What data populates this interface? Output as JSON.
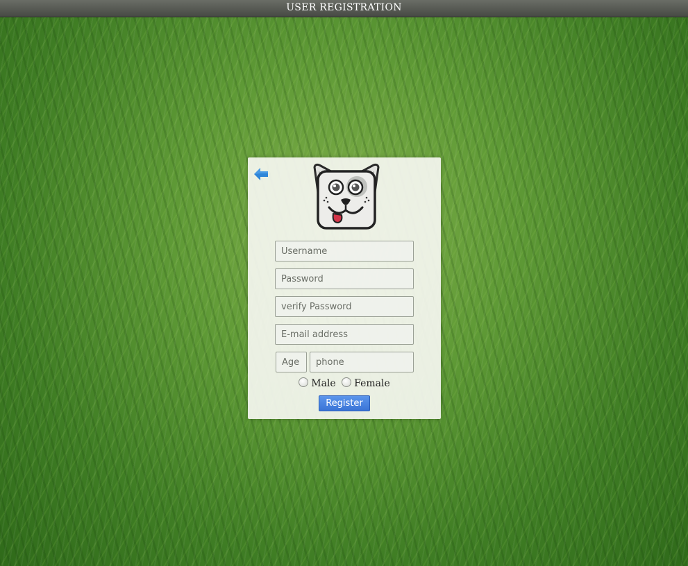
{
  "window": {
    "title": "USER REGISTRATION"
  },
  "form": {
    "back_icon": "back-arrow-icon",
    "logo_icon": "cartoon-dog-face-logo",
    "username": {
      "placeholder": "Username",
      "value": ""
    },
    "password": {
      "placeholder": "Password",
      "value": ""
    },
    "verify_password": {
      "placeholder": "verify Password",
      "value": ""
    },
    "email": {
      "placeholder": "E-mail address",
      "value": ""
    },
    "age": {
      "placeholder": "Age",
      "value": ""
    },
    "phone": {
      "placeholder": "phone",
      "value": ""
    },
    "gender_options": [
      {
        "label": "Male",
        "selected": false
      },
      {
        "label": "Female",
        "selected": false
      }
    ],
    "register_label": "Register"
  },
  "colors": {
    "accent_button": "#3a74d6",
    "back_arrow": "#2f86d8",
    "title_bar": "#4f524b"
  }
}
